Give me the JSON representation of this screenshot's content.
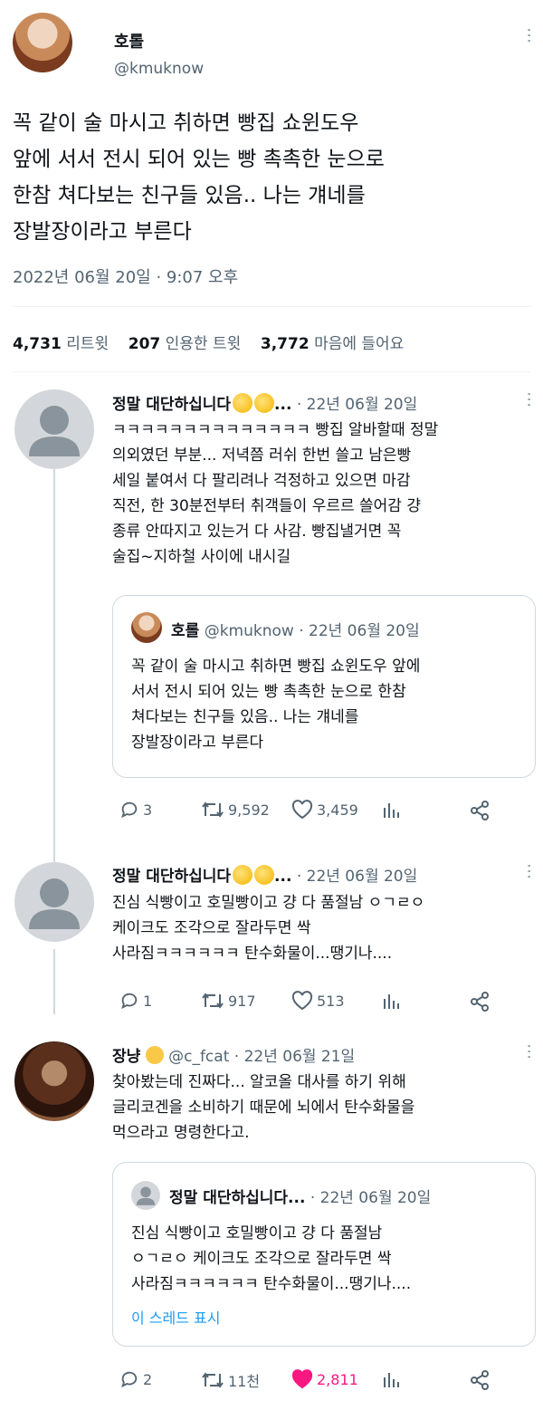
{
  "main_tweet": {
    "display_name": "호롤",
    "handle": "@kmuknow",
    "text_lines": [
      "꼭 같이 술 마시고 취하면 빵집 쇼윈도우",
      "앞에 서서 전시 되어 있는 빵 촉촉한 눈으로",
      "한참 쳐다보는 친구들 있음.. 나는 걔네를",
      "장발장이라고 부른다"
    ],
    "timestamp": "2022년 06월 20일 · 9:07 오후"
  },
  "stats": {
    "retweets_count": "4,731",
    "retweets_label": "리트윗",
    "quotes_count": "207",
    "quotes_label": "인용한 트윗",
    "likes_count": "3,772",
    "likes_label": "마음에 들어요"
  },
  "replies": [
    {
      "display_name": "정말 대단하십니다",
      "ellipsis": "...",
      "date": "· 22년 06월 20일",
      "text_lines": [
        "ㅋㅋㅋㅋㅋㅋㅋㅋㅋㅋㅋㅋㅋㅋ 빵집 알바할때 정말",
        "의외였던 부분... 저녁쯤 러쉬 한번 쓸고 남은빵",
        "세일 붙여서 다 팔리려나 걱정하고 있으면 마감",
        "직전, 한 30분전부터 취객들이 우르르 쓸어감 걍",
        "종류 안따지고 있는거 다 사감. 빵집낼거면 꼭",
        "술집~지하철 사이에 내시길"
      ],
      "quoted": {
        "display_name": "호롤",
        "handle": "@kmuknow",
        "date": "· 22년 06월 20일",
        "text_lines": [
          "꼭 같이 술 마시고 취하면 빵집 쇼윈도우 앞에",
          "서서 전시 되어 있는 빵 촉촉한 눈으로 한참",
          "쳐다보는 친구들 있음.. 나는 걔네를",
          "장발장이라고 부른다"
        ]
      },
      "actions": {
        "replies": "3",
        "retweets": "9,592",
        "likes": "3,459"
      }
    },
    {
      "display_name": "정말 대단하십니다",
      "ellipsis": "...",
      "date": "· 22년 06월 20일",
      "text_lines": [
        "진심 식빵이고 호밀빵이고 걍 다 품절남 ㅇㄱㄹㅇ",
        "케이크도 조각으로 잘라두면 싹",
        "사라짐ㅋㅋㅋㅋㅋㅋ 탄수화물이...땡기나...."
      ],
      "actions": {
        "replies": "1",
        "retweets": "917",
        "likes": "513"
      }
    },
    {
      "display_name": "장냥",
      "handle": "@c_fcat",
      "date": "· 22년 06월 21일",
      "text_lines": [
        "찾아봤는데 진짜다... 알코올 대사를 하기 위해",
        "글리코겐을 소비하기 때문에 뇌에서 탄수화물을",
        "먹으라고 명령한다고."
      ],
      "quoted": {
        "display_name": "정말 대단하십니다...",
        "date": "· 22년 06월 20일",
        "text_lines": [
          "진심 식빵이고 호밀빵이고 걍 다 품절남",
          "ㅇㄱㄹㅇ 케이크도 조각으로 잘라두면 싹",
          "사라짐ㅋㅋㅋㅋㅋㅋ 탄수화물이...땡기나...."
        ],
        "show_thread": "이 스레드 표시"
      },
      "actions": {
        "replies": "2",
        "retweets": "11천",
        "likes": "2,811"
      }
    }
  ],
  "colors": {
    "text": "#0f1419",
    "muted": "#536471",
    "border": "#cfd9de",
    "link": "#1d9bf0",
    "like_active": "#f91880"
  }
}
